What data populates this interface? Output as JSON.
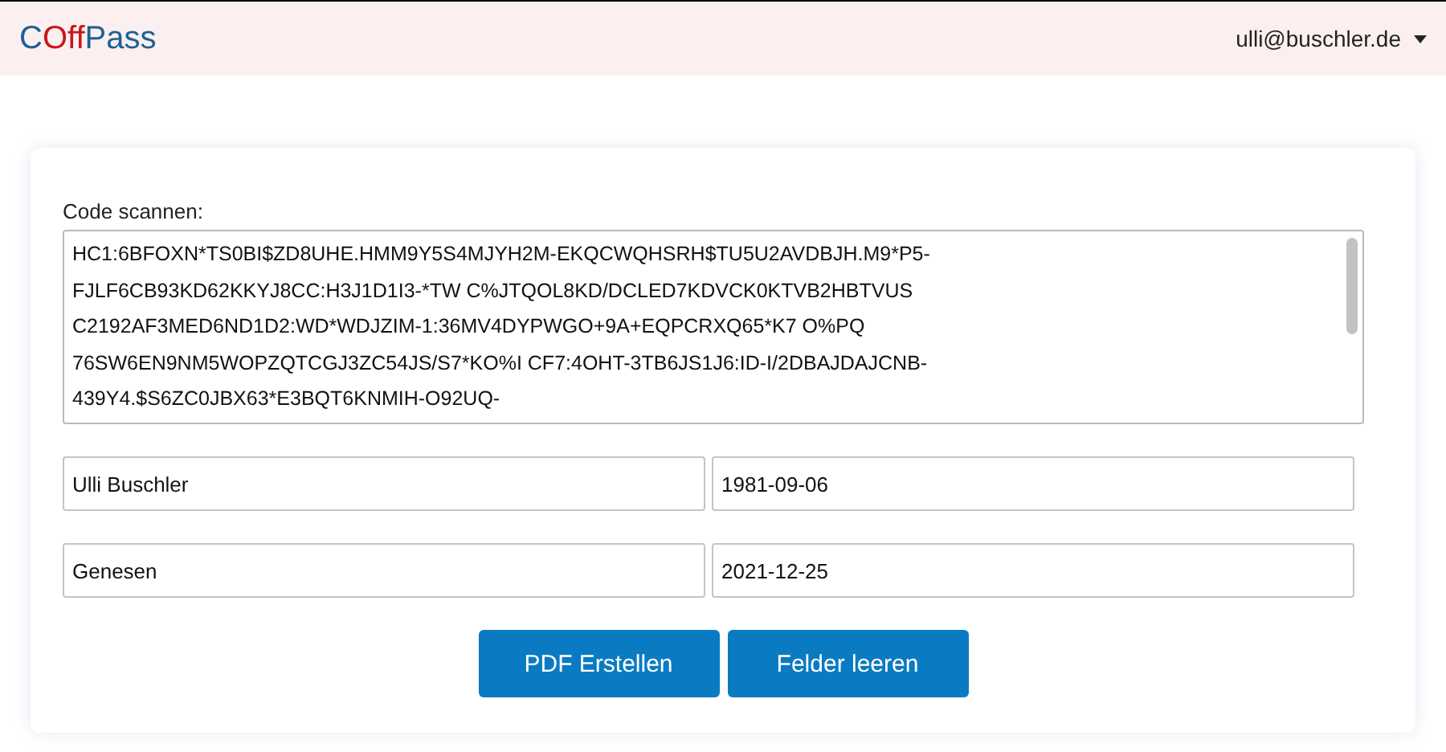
{
  "navbar": {
    "logo": [
      {
        "text": "C",
        "color": "#1d5f96"
      },
      {
        "text": "Off",
        "color": "#c8161d"
      },
      {
        "text": "Pass",
        "color": "#1d5f96"
      }
    ],
    "user_menu": "ulli@buschler.de"
  },
  "form": {
    "code_label": "Code scannen:",
    "code_lines": [
      "HC1:6BFOXN*TS0BI$ZD8UHE.HMM9Y5S4MJYH2M-EKQCWQHSRH$TU5U2AVDBJH.M9*P5-",
      "FJLF6CB93KD62KKYJ8CC:H3J1D1I3-*TW C%JTQOL8KD/DCLED7KDVCK0KTVB2HBTVUS",
      "C2192AF3MED6ND1D2:WD*WDJZIM-1:36MV4DYPWGO+9A+EQPCRXQ65*K7 O%PQ",
      "76SW6EN9NM5WOPZQTCGJ3ZC54JS/S7*KO%I CF7:4OHT-3TB6JS1J6:ID-I/2DBAJDAJCNB-",
      "439Y4.$S6ZC0JBX63*E3BQT6KNMIH-O92UQ-"
    ],
    "fields": [
      [
        "Ulli Buschler",
        "1981-09-06"
      ],
      [
        "Genesen",
        "2021-12-25"
      ]
    ],
    "buttons": [
      "PDF Erstellen",
      "Felder leeren"
    ]
  }
}
